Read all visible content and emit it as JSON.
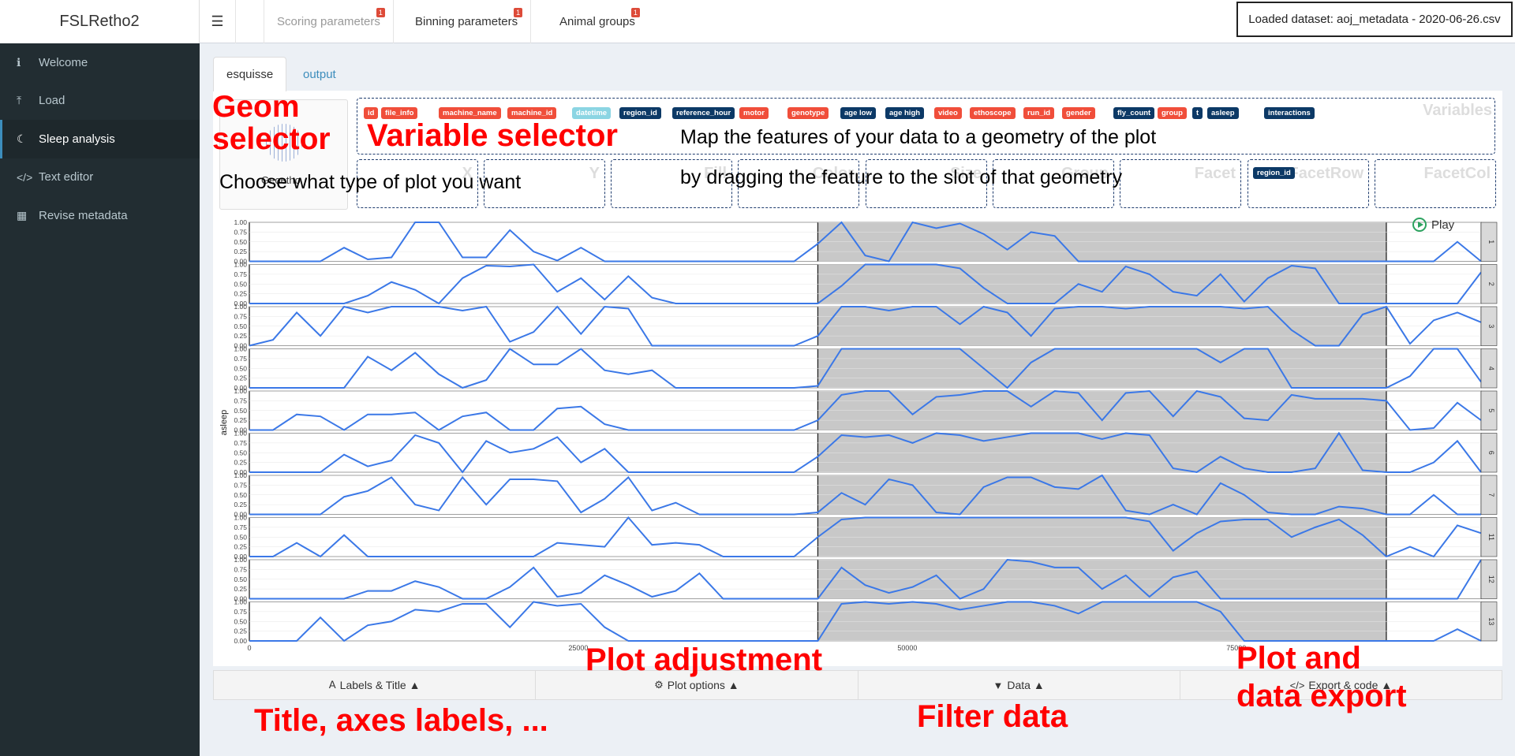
{
  "header": {
    "brand": "FSLRetho2",
    "toggle_icon": "hamburger-icon",
    "nav_tabs": [
      {
        "label": "Scoring parameters",
        "badge": "1",
        "muted": true
      },
      {
        "label": "Binning parameters",
        "badge": "1",
        "muted": false
      },
      {
        "label": "Animal groups",
        "badge": "1",
        "muted": false
      }
    ],
    "loaded_dataset": "Loaded dataset: aoj_metadata - 2020-06-26.csv"
  },
  "sidebar": {
    "items": [
      {
        "label": "Welcome",
        "icon": "info-icon",
        "active": false
      },
      {
        "label": "Load",
        "icon": "upload-icon",
        "active": false
      },
      {
        "label": "Sleep analysis",
        "icon": "moon-icon",
        "active": true
      },
      {
        "label": "Text editor",
        "icon": "code-icon",
        "active": false
      },
      {
        "label": "Revise metadata",
        "icon": "table-icon",
        "active": false
      }
    ]
  },
  "main": {
    "tabs": [
      {
        "label": "esquisse"
      },
      {
        "label": "output"
      }
    ],
    "geom_label": "Geoetho",
    "variables_title": "Variables",
    "variables": [
      {
        "label": "id",
        "kind": "nominal"
      },
      {
        "label": "file_info",
        "kind": "nominal"
      },
      {
        "label": "machine_name",
        "kind": "nominal"
      },
      {
        "label": "machine_id",
        "kind": "nominal"
      },
      {
        "label": "datetime",
        "kind": "datetime"
      },
      {
        "label": "region_id",
        "kind": "continuous"
      },
      {
        "label": "reference_hour",
        "kind": "continuous"
      },
      {
        "label": "motor",
        "kind": "nominal"
      },
      {
        "label": "genotype",
        "kind": "nominal"
      },
      {
        "label": "age low",
        "kind": "continuous"
      },
      {
        "label": "age high",
        "kind": "continuous"
      },
      {
        "label": "video",
        "kind": "nominal"
      },
      {
        "label": "ethoscope",
        "kind": "nominal"
      },
      {
        "label": "run_id",
        "kind": "nominal"
      },
      {
        "label": "gender",
        "kind": "nominal"
      },
      {
        "label": "fly_count",
        "kind": "continuous"
      },
      {
        "label": "group",
        "kind": "nominal"
      },
      {
        "label": "t",
        "kind": "continuous"
      },
      {
        "label": "asleep",
        "kind": "continuous"
      },
      {
        "label": "interactions",
        "kind": "continuous"
      }
    ],
    "slots": [
      {
        "label": "X",
        "value": ""
      },
      {
        "label": "Y",
        "value": ""
      },
      {
        "label": "Fill",
        "value": ""
      },
      {
        "label": "Color",
        "value": ""
      },
      {
        "label": "Size",
        "value": ""
      },
      {
        "label": "Group",
        "value": ""
      },
      {
        "label": "Facet",
        "value": ""
      },
      {
        "label": "FacetRow",
        "value": "region_id"
      },
      {
        "label": "FacetCol",
        "value": ""
      }
    ],
    "play_label": "Play",
    "bottom_buttons": [
      {
        "label": "Labels & Title",
        "icon": "font-icon"
      },
      {
        "label": "Plot options",
        "icon": "gears-icon"
      },
      {
        "label": "Data",
        "icon": "filter-icon"
      },
      {
        "label": "Export & code",
        "icon": "code-icon"
      }
    ]
  },
  "annotations": {
    "geom_selector": "Geom\nselector",
    "variable_selector": "Variable selector",
    "map_text_1": "Map the features of your data to a geometry of the plot",
    "map_text_2": "by dragging the feature to the slot of that geometry",
    "choose_text": "Choose what type of plot you want",
    "plot_adjustment": "Plot adjustment",
    "plot_export": "Plot and\ndata export",
    "title_axes": "Title, axes labels, ...",
    "filter_data": "Filter data"
  },
  "chart_data": {
    "type": "line",
    "ylabel": "asleep",
    "xlabel": "",
    "xlim": [
      0,
      93600
    ],
    "ylim": [
      0,
      1
    ],
    "x_ticks": [
      0,
      25000,
      50000,
      75000
    ],
    "y_ticks": [
      "0.00",
      "0.25",
      "0.50",
      "0.75",
      "1.00"
    ],
    "dark_period": [
      43200,
      86400
    ],
    "line_color": "#3b78e7",
    "facet_labels": [
      "1",
      "2",
      "3",
      "4",
      "5",
      "6",
      "7",
      "11",
      "12",
      "13"
    ],
    "x": [
      0,
      1800,
      3600,
      5400,
      7200,
      9000,
      10800,
      12600,
      14400,
      16200,
      18000,
      19800,
      21600,
      23400,
      25200,
      27000,
      28800,
      30600,
      32400,
      34200,
      36000,
      37800,
      39600,
      41400,
      43200,
      45000,
      46800,
      48600,
      50400,
      52200,
      54000,
      55800,
      57600,
      59400,
      61200,
      63000,
      64800,
      66600,
      68400,
      70200,
      72000,
      73800,
      75600,
      77400,
      79200,
      81000,
      82800,
      84600,
      86400,
      88200,
      90000,
      91800,
      93600
    ],
    "series": [
      {
        "name": "1",
        "values": [
          0,
          0,
          0,
          0,
          0.35,
          0.05,
          0.1,
          1,
          1,
          0.1,
          0.1,
          0.8,
          0.25,
          0.02,
          0.35,
          0,
          0,
          0,
          0,
          0,
          0,
          0,
          0,
          0,
          0.45,
          1,
          0.15,
          0,
          1,
          0.85,
          0.97,
          0.7,
          0.3,
          0.75,
          0.65,
          0,
          0,
          0,
          0,
          0,
          0,
          0,
          0,
          0,
          0,
          0,
          0,
          0,
          0,
          0,
          0,
          0.5,
          0
        ]
      },
      {
        "name": "2",
        "values": [
          0,
          0,
          0,
          0,
          0,
          0.2,
          0.55,
          0.35,
          0,
          0.65,
          0.97,
          0.95,
          1,
          0.3,
          0.65,
          0.1,
          0.7,
          0.15,
          0,
          0,
          0,
          0,
          0,
          0,
          0,
          0.45,
          1,
          1,
          1,
          1,
          0.9,
          0.4,
          0,
          0,
          0,
          0.5,
          0.3,
          0.95,
          0.75,
          0.3,
          0.2,
          0.75,
          0.05,
          0.65,
          0.97,
          0.9,
          0,
          0,
          0,
          0,
          0,
          0,
          0.8
        ]
      },
      {
        "name": "3",
        "values": [
          0,
          0.15,
          0.85,
          0.25,
          1,
          0.85,
          1,
          1,
          1,
          0.9,
          1,
          0.1,
          0.35,
          1,
          0.3,
          1,
          0.95,
          0,
          0,
          0,
          0,
          0,
          0,
          0,
          0.25,
          1,
          1,
          0.9,
          1,
          1,
          0.55,
          1,
          0.85,
          0.25,
          0.95,
          1,
          1,
          0.95,
          1,
          1,
          1,
          1,
          0.95,
          1,
          0.4,
          0,
          0,
          0.8,
          1,
          0.05,
          0.65,
          0.85,
          0.6
        ]
      },
      {
        "name": "4",
        "values": [
          0,
          0,
          0,
          0,
          0,
          0.8,
          0.45,
          0.9,
          0.35,
          0,
          0.2,
          1,
          0.6,
          0.6,
          1,
          0.45,
          0.35,
          0.45,
          0,
          0,
          0,
          0,
          0,
          0,
          0.05,
          1,
          1,
          1,
          1,
          1,
          1,
          0.5,
          0,
          0.65,
          1,
          1,
          1,
          1,
          1,
          1,
          1,
          0.65,
          1,
          1,
          0,
          0,
          0,
          0,
          0,
          0.3,
          1,
          1,
          0.15
        ]
      },
      {
        "name": "5",
        "values": [
          0,
          0,
          0.4,
          0.35,
          0,
          0.4,
          0.4,
          0.45,
          0,
          0.35,
          0.45,
          0,
          0,
          0.55,
          0.6,
          0.15,
          0,
          0,
          0,
          0,
          0,
          0,
          0,
          0,
          0.25,
          0.9,
          1,
          1,
          0.4,
          0.85,
          0.9,
          1,
          1,
          0.6,
          1,
          0.95,
          0.25,
          0.95,
          1,
          0.35,
          1,
          0.85,
          0.3,
          0.25,
          0.9,
          0.8,
          0.8,
          0.8,
          0.75,
          0,
          0.05,
          0.7,
          0.25
        ]
      },
      {
        "name": "6",
        "values": [
          0,
          0,
          0,
          0,
          0.45,
          0.15,
          0.3,
          0.95,
          0.75,
          0,
          0.8,
          0.5,
          0.6,
          0.9,
          0.25,
          0.6,
          0,
          0,
          0,
          0,
          0,
          0,
          0,
          0,
          0.4,
          0.95,
          0.9,
          0.95,
          0.75,
          1,
          0.95,
          0.8,
          0.9,
          1,
          1,
          1,
          0.85,
          1,
          0.95,
          0.1,
          0,
          0.4,
          0.1,
          0,
          0,
          0.1,
          1,
          0.05,
          0,
          0,
          0.25,
          0.8,
          0
        ]
      },
      {
        "name": "7",
        "values": [
          0,
          0,
          0,
          0,
          0.45,
          0.6,
          0.95,
          0.25,
          0.1,
          0.95,
          0.25,
          0.9,
          0.9,
          0.85,
          0.05,
          0.4,
          0.95,
          0.1,
          0.3,
          0,
          0,
          0,
          0,
          0,
          0.05,
          0.55,
          0.25,
          0.9,
          0.75,
          0.05,
          0,
          0.7,
          0.95,
          0.95,
          0.7,
          0.65,
          1,
          0.1,
          0,
          0.25,
          0,
          0.8,
          0.5,
          0.05,
          0,
          0,
          0.2,
          0.15,
          0,
          0,
          0.5,
          0,
          0
        ]
      },
      {
        "name": "11",
        "values": [
          0,
          0,
          0.35,
          0,
          0.55,
          0,
          0,
          0,
          0,
          0,
          0,
          0,
          0,
          0.35,
          0.3,
          0.25,
          1,
          0.3,
          0.35,
          0.3,
          0,
          0,
          0,
          0,
          0.5,
          0.95,
          1,
          1,
          1,
          1,
          1,
          1,
          1,
          1,
          1,
          1,
          1,
          1,
          0.9,
          0.15,
          0.6,
          0.9,
          0.95,
          0.95,
          0.5,
          0.75,
          0.95,
          0.55,
          0,
          0.25,
          0,
          0.8,
          0.6
        ]
      },
      {
        "name": "12",
        "values": [
          0,
          0,
          0,
          0,
          0,
          0.2,
          0.2,
          0.45,
          0.3,
          0,
          0,
          0.3,
          0.8,
          0.05,
          0.15,
          0.6,
          0.35,
          0.05,
          0.2,
          0.65,
          0,
          0,
          0,
          0,
          0,
          0.8,
          0.35,
          0.15,
          0.3,
          0.6,
          0,
          0.25,
          1,
          0.95,
          0.8,
          0.8,
          0.25,
          0.6,
          0.05,
          0.55,
          0.7,
          0,
          0,
          0,
          0,
          0,
          0,
          0,
          0,
          0,
          0,
          0,
          1
        ]
      },
      {
        "name": "13",
        "values": [
          0,
          0,
          0,
          0.6,
          0,
          0.4,
          0.5,
          0.8,
          0.75,
          0.95,
          0.95,
          0.35,
          1,
          0.9,
          0.95,
          0.35,
          0,
          0,
          0,
          0,
          0,
          0,
          0,
          0,
          0,
          0.95,
          1,
          0.95,
          1,
          0.95,
          0.8,
          0.9,
          1,
          1,
          0.9,
          0.7,
          1,
          1,
          1,
          1,
          1,
          0.75,
          0,
          0,
          0,
          0,
          0,
          0,
          0,
          0,
          0,
          0.3,
          0
        ]
      }
    ]
  }
}
